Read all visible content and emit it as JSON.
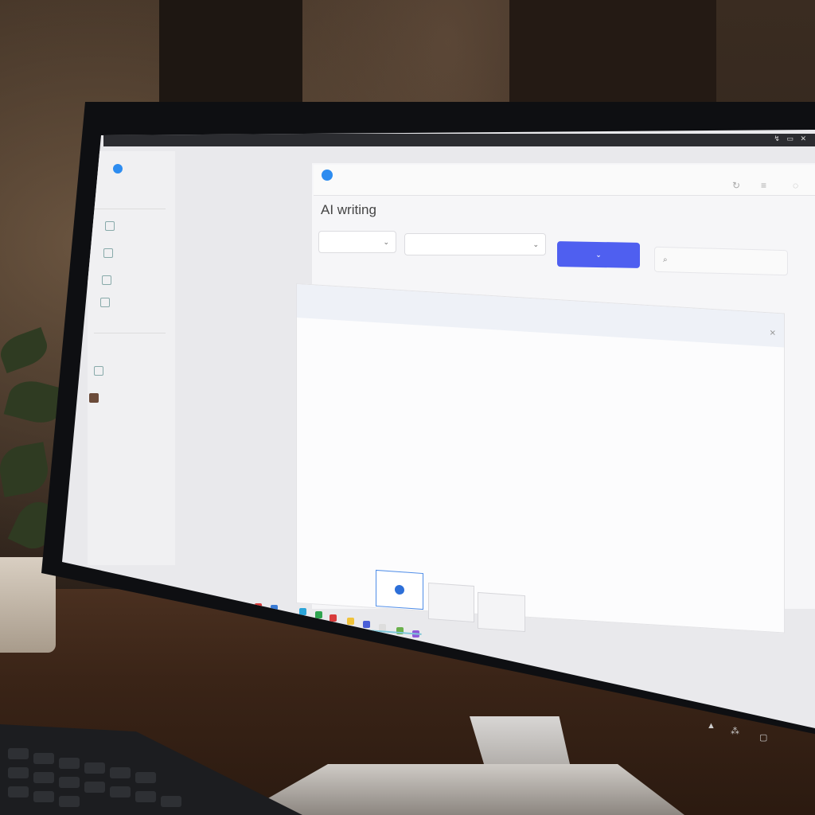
{
  "window": {
    "title": "AI writing",
    "topbar_icons": "↯ ▭ ✕"
  },
  "header": {
    "icons": [
      "refresh-icon",
      "menu-icon",
      "chat-icon"
    ]
  },
  "search": {
    "icon": "search-icon"
  },
  "actions": [
    {
      "icon": "g-icon"
    }
  ],
  "colors": {
    "primary": "#4f5ff0",
    "accent_blue": "#2d8cf0",
    "accent_green": "#3f9b5a",
    "screen_bg": "#e9e9ec"
  }
}
